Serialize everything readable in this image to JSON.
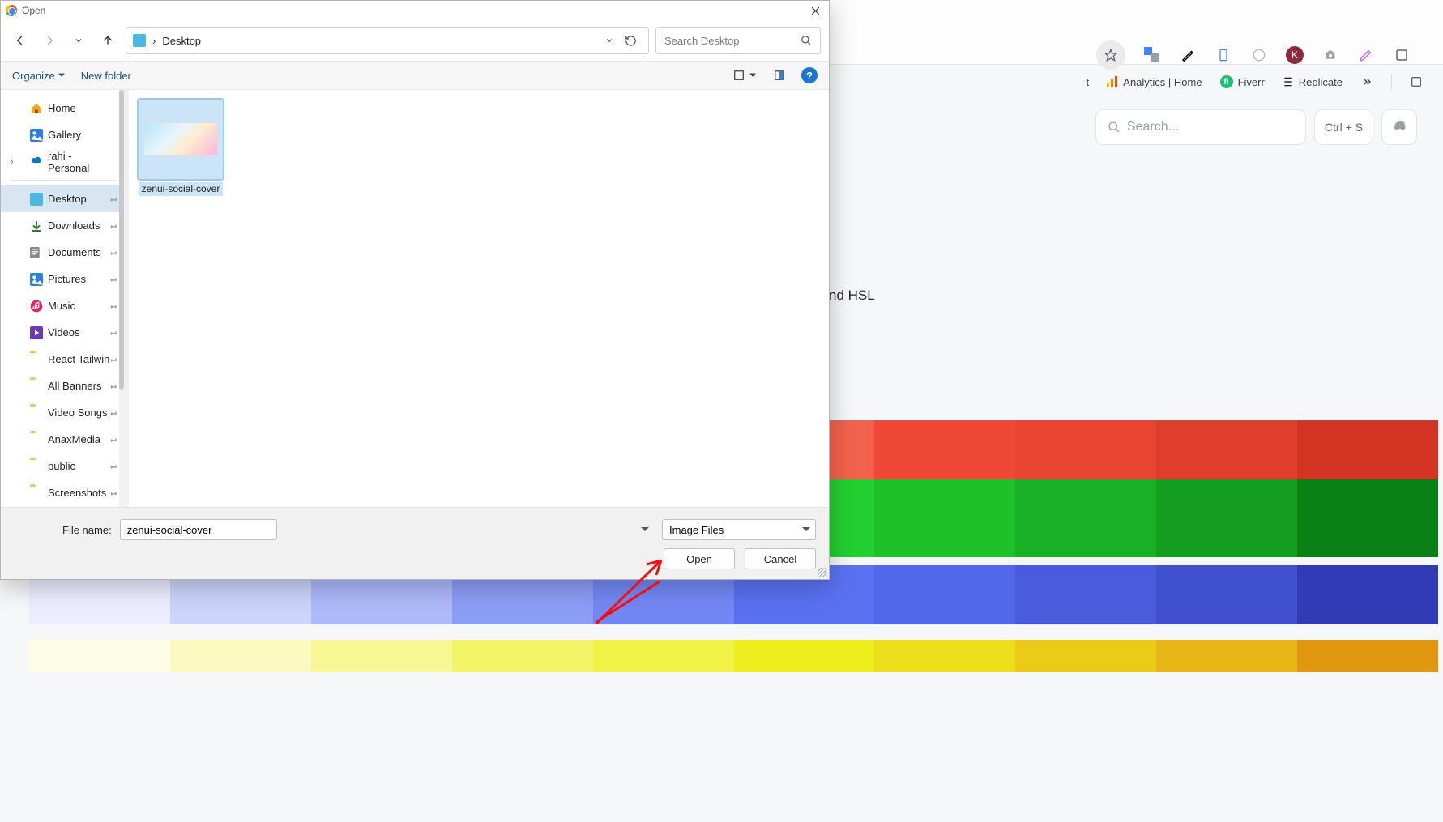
{
  "dialog": {
    "title": "Open",
    "breadcrumb": {
      "root": "›",
      "location": "Desktop"
    },
    "search_placeholder": "Search Desktop",
    "organize_label": "Organize",
    "new_folder_label": "New folder",
    "sidebar": {
      "home": "Home",
      "gallery": "Gallery",
      "personal": "rahi - Personal",
      "pinned": [
        "Desktop",
        "Downloads",
        "Documents",
        "Pictures",
        "Music",
        "Videos",
        "React Tailwin",
        "All Banners",
        "Video Songs",
        "AnaxMedia",
        "public",
        "Screenshots"
      ]
    },
    "files": [
      {
        "name": "zenui-social-cover"
      }
    ],
    "file_name_label": "File name:",
    "file_name_value": "zenui-social-cover",
    "file_type_value": "Image Files",
    "open_label": "Open",
    "cancel_label": "Cancel"
  },
  "background": {
    "search_placeholder": "Search...",
    "search_kbd": "Ctrl + S",
    "visible_text": "nd HSL",
    "bookmarks": {
      "analytics": "Analytics | Home",
      "fiverr": "Fiverr",
      "replicate": "Replicate"
    },
    "palette_red": [
      "#fdeceb",
      "#fad2cd",
      "#f7b5ad",
      "#f59a8e",
      "#f47e6e",
      "#f3624e",
      "#f04836",
      "#e94432",
      "#df3e2c",
      "#d23524"
    ],
    "palette_green": [
      "#e7f9e9",
      "#c5f1c9",
      "#9ee8a3",
      "#73df7b",
      "#4dd757",
      "#23ce30",
      "#1fc12b",
      "#1ab025",
      "#149e1f",
      "#0b8016"
    ],
    "palette_blue": [
      "#ebeefe",
      "#cdd4fb",
      "#adb9f9",
      "#8c9df6",
      "#7387f4",
      "#5a71f2",
      "#5268ea",
      "#4a5cdc",
      "#4150ce",
      "#313bb5"
    ],
    "palette_yellow": [
      "#fdfde6",
      "#fafac0",
      "#f7f795",
      "#f4f469",
      "#f1f146",
      "#eeee1e",
      "#ecdf1c",
      "#e9cb18",
      "#e6b715",
      "#e0960f"
    ]
  }
}
